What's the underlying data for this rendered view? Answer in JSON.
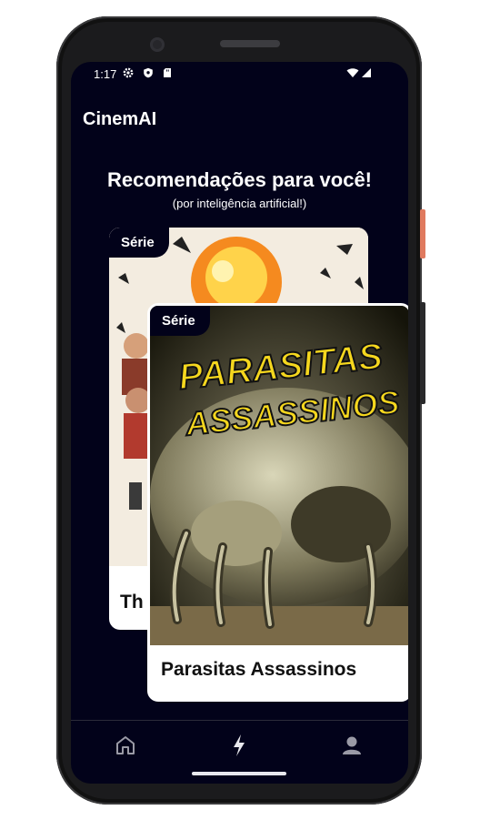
{
  "status_bar": {
    "time": "1:17"
  },
  "app": {
    "title": "CinemAI"
  },
  "header": {
    "title": "Recomendações para você!",
    "subtitle": "(por inteligência artificial!)"
  },
  "cards": [
    {
      "badge": "Série",
      "title": "Th"
    },
    {
      "badge": "Série",
      "title": "Parasitas Assassinos",
      "poster_text_line1": "PARASITAS",
      "poster_text_line2": "ASSASSINOS"
    }
  ],
  "nav": {
    "items": [
      "home-icon",
      "bolt-icon",
      "profile-icon"
    ],
    "active_index": 1
  },
  "colors": {
    "background": "#02021a",
    "poster_text": "#f5d71e",
    "accent_icon": "#e9e9ee"
  }
}
